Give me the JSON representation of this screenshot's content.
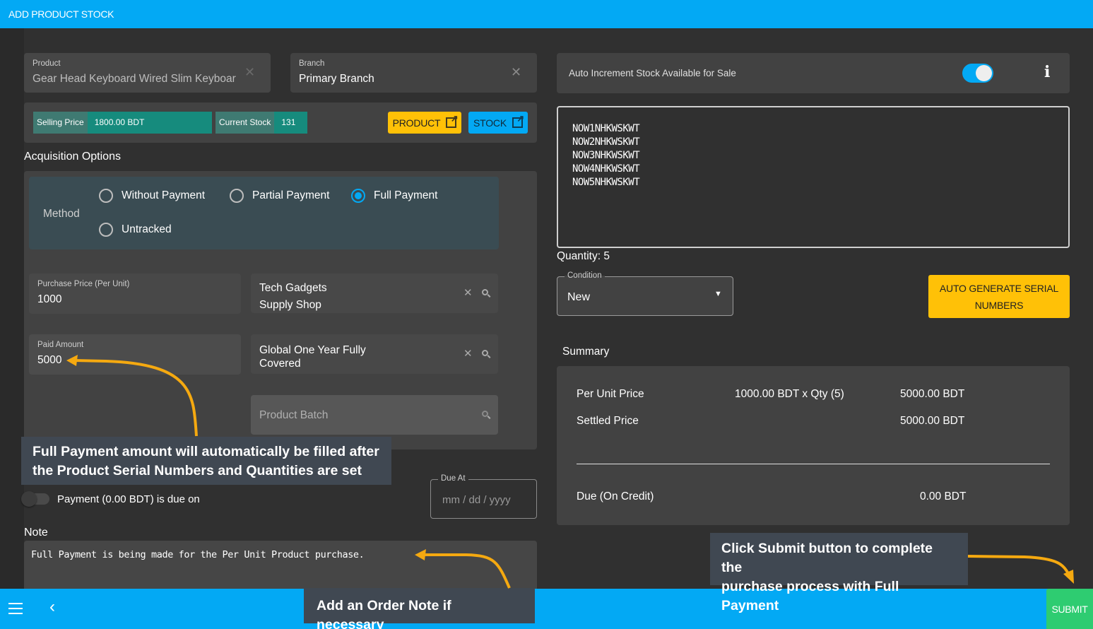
{
  "header": {
    "title": "ADD PRODUCT STOCK"
  },
  "product": {
    "label": "Product",
    "value": "Gear Head Keyboard Wired Slim Keyboar"
  },
  "branch": {
    "label": "Branch",
    "value": "Primary Branch"
  },
  "info_chips": {
    "selling_price_label": "Selling Price",
    "selling_price_value": "1800.00 BDT",
    "current_stock_label": "Current Stock",
    "current_stock_value": "131"
  },
  "buttons": {
    "product": "PRODUCT",
    "stock": "STOCK",
    "auto_generate": "AUTO GENERATE SERIAL NUMBERS",
    "submit": "SUBMIT"
  },
  "acquisition": {
    "title": "Acquisition Options",
    "method_label": "Method",
    "options": [
      {
        "label": "Without Payment",
        "selected": false
      },
      {
        "label": "Partial Payment",
        "selected": false
      },
      {
        "label": "Full Payment",
        "selected": true
      },
      {
        "label": "Untracked",
        "selected": false
      }
    ]
  },
  "purchase_price": {
    "label": "Purchase Price (Per Unit)",
    "value": "1000"
  },
  "supplier": {
    "value_line1": "Tech Gadgets",
    "value_line2": "Supply Shop"
  },
  "paid_amount": {
    "label": "Paid Amount",
    "value": "5000"
  },
  "warranty": {
    "value_line1": "Global One Year Fully",
    "value_line2": "Covered"
  },
  "product_batch": {
    "placeholder": "Product Batch"
  },
  "payment_due": {
    "toggle_label": "Payment (0.00 BDT) is due on",
    "enabled": false
  },
  "due_at": {
    "label": "Due At",
    "placeholder": "mm / dd / yyyy"
  },
  "note": {
    "label": "Note",
    "value": "Full Payment is being made for the Per Unit Product purchase."
  },
  "auto_increment": {
    "label": "Auto Increment Stock Available for Sale",
    "enabled": true
  },
  "serial_numbers": [
    "NOW1NHKWSKWT",
    "NOW2NHKWSKWT",
    "NOW3NHKWSKWT",
    "NOW4NHKWSKWT",
    "NOW5NHKWSKWT"
  ],
  "quantity": {
    "text": "Quantity: 5"
  },
  "condition": {
    "label": "Condition",
    "value": "New"
  },
  "summary": {
    "title": "Summary",
    "per_unit_label": "Per Unit Price",
    "per_unit_calc": "1000.00 BDT x Qty (5)",
    "per_unit_total": "5000.00 BDT",
    "settled_label": "Settled Price",
    "settled_value": "5000.00 BDT",
    "due_label": "Due (On Credit)",
    "due_value": "0.00 BDT"
  },
  "callouts": {
    "paid_amount": "Full Payment amount will automatically be filled after the Product Serial Numbers and Quantities are set",
    "paid_amount_line1": "Full Payment amount will automatically be filled after",
    "paid_amount_line2": "the Product Serial Numbers and Quantities are set",
    "note_line": "Add an Order Note if necessary",
    "submit_line1": "Click Submit button to complete the",
    "submit_line2": "purchase process with Full Payment"
  },
  "colors": {
    "primary": "#03a9f4",
    "accent_yellow": "#ffc107",
    "submit_green": "#2ecc71",
    "teal": "#168b7d",
    "arrow": "#f5a910"
  }
}
